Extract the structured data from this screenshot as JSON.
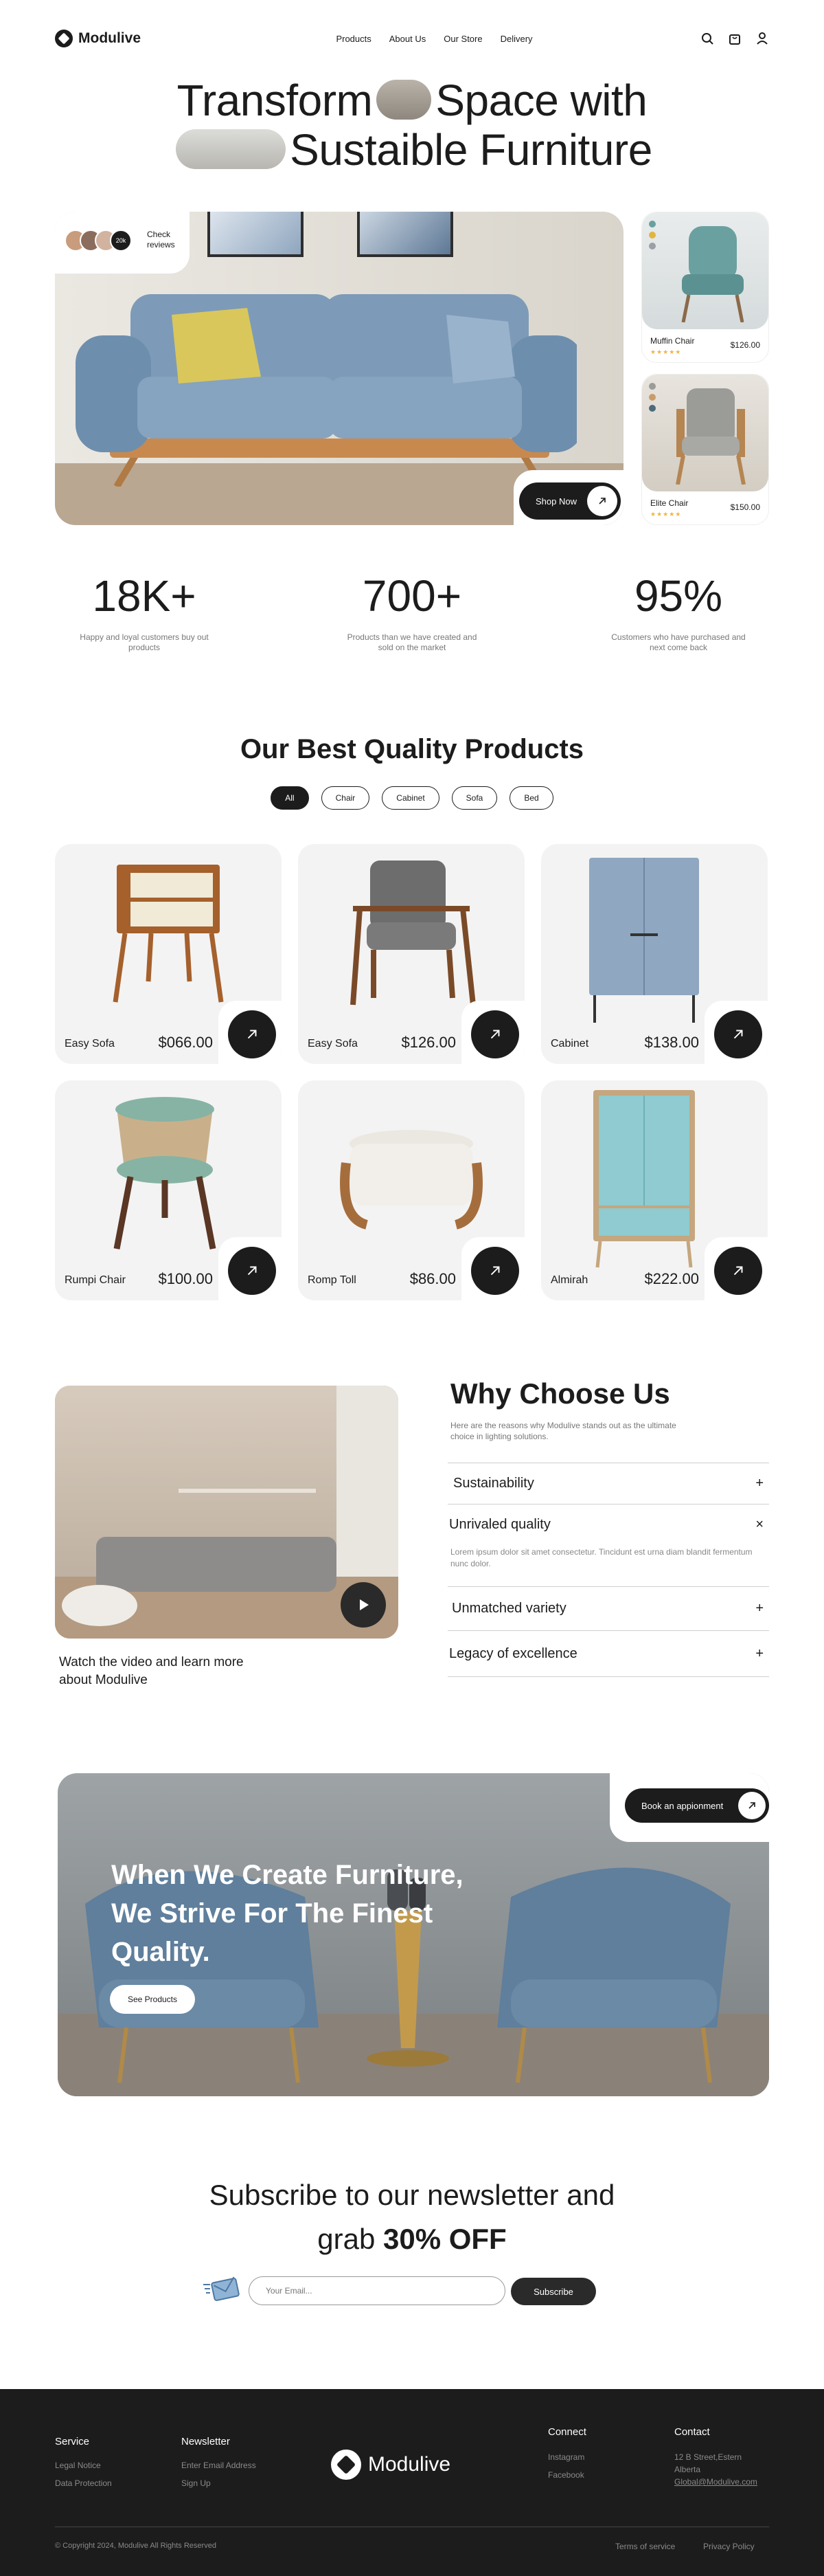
{
  "nav": {
    "brand": "Modulive",
    "menu": [
      "Products",
      "About Us",
      "Our Store",
      "Delivery"
    ],
    "icons": [
      "search-icon",
      "bag-icon",
      "user-icon"
    ]
  },
  "hero": {
    "line1_a": "Transform",
    "line1_b": "Space with",
    "line2": "Sustaible Furniture",
    "reviews_label": "Check reviews",
    "reviews_count": "20k",
    "shop_button": "Shop Now"
  },
  "side_products": [
    {
      "name": "Muffin Chair",
      "price": "$126.00",
      "stars": "★★★★★"
    },
    {
      "name": "Elite Chair",
      "price": "$150.00",
      "stars": "★★★★★"
    }
  ],
  "stats": [
    {
      "value": "18K+",
      "desc": "Happy and loyal customers buy out products"
    },
    {
      "value": "700+",
      "desc": "Products than we have created and sold on the market"
    },
    {
      "value": "95%",
      "desc": "Customers who have purchased and next come back"
    }
  ],
  "products_section": {
    "title": "Our Best Quality Products",
    "filters": [
      "All",
      "Chair",
      "Cabinet",
      "Sofa",
      "Bed"
    ],
    "active_filter": "All",
    "items": [
      {
        "name": "Easy Sofa",
        "price": "$066.00"
      },
      {
        "name": "Easy Sofa",
        "price": "$126.00"
      },
      {
        "name": "Cabinet",
        "price": "$138.00"
      },
      {
        "name": "Rumpi Chair",
        "price": "$100.00"
      },
      {
        "name": "Romp Toll",
        "price": "$86.00"
      },
      {
        "name": "Almirah",
        "price": "$222.00"
      }
    ]
  },
  "why": {
    "title": "Why Choose Us",
    "subtitle": "Here are the reasons why Modulive stands out as the ultimate choice in lighting solutions.",
    "video_caption": "Watch the video and learn more about Modulive",
    "items": [
      {
        "title": "Sustainability",
        "toggle": "+"
      },
      {
        "title": "Unrivaled quality",
        "toggle": "×",
        "body": "Lorem ipsum dolor sit amet consectetur. Tincidunt est urna diam blandit fermentum nunc dolor."
      },
      {
        "title": "Unmatched variety",
        "toggle": "+"
      },
      {
        "title": "Legacy of excellence",
        "toggle": "+"
      }
    ]
  },
  "banner": {
    "headline": "When We Create Furniture, We Strive For The Finest Quality.",
    "book_button": "Book an appionment",
    "see_button": "See Products"
  },
  "newsletter": {
    "line1": "Subscribe to our newsletter and",
    "line2_a": "grab ",
    "line2_b": "30% OFF",
    "email_placeholder": "Your Email...",
    "button": "Subscribe"
  },
  "footer": {
    "service": {
      "title": "Service",
      "links": [
        "Legal Notice",
        "Data Protection"
      ]
    },
    "newsletter": {
      "title": "Newsletter",
      "links": [
        "Enter Email Address",
        "Sign Up"
      ]
    },
    "brand": "Modulive",
    "connect": {
      "title": "Connect",
      "links": [
        "Instagram",
        "Facebook"
      ]
    },
    "contact": {
      "title": "Contact",
      "lines": [
        "12 B Street,Estern",
        "Alberta",
        "Global@Modulive.com"
      ]
    },
    "copyright": "© Copyright 2024, Modulive All Rights Reserved",
    "bottom_links": [
      "Terms of service",
      "Privacy Policy"
    ]
  },
  "colors": {
    "dark": "#1c1c1c",
    "card": "#f3f3f3",
    "muted": "#777777",
    "star": "#f2b53a"
  }
}
